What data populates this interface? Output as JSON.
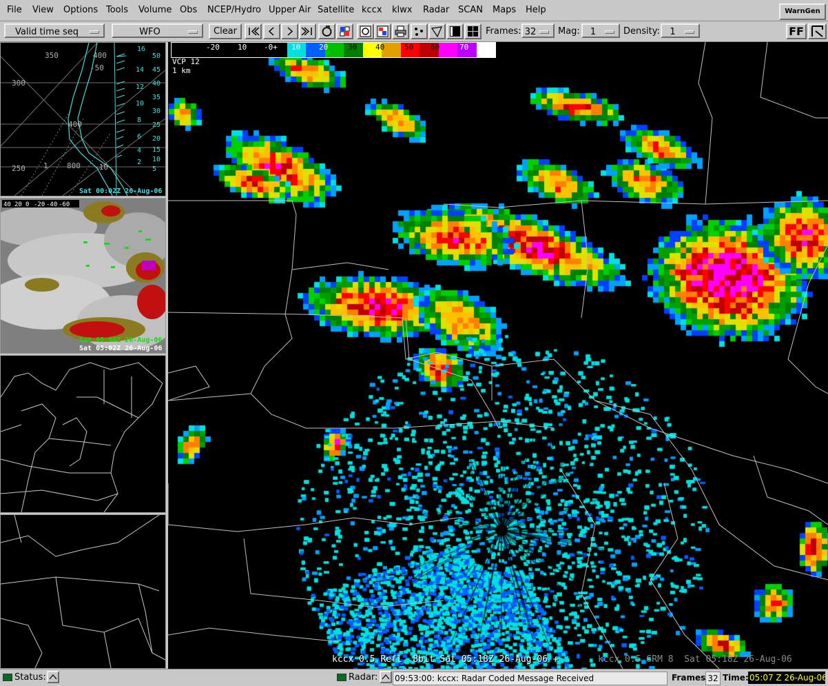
{
  "menubar": {
    "items": [
      "File",
      "View",
      "Options",
      "Tools",
      "Volume",
      "Obs",
      "NCEP/Hydro",
      "Upper Air",
      "Satellite",
      "kccx",
      "klwx",
      "Radar",
      "SCAN",
      "Maps",
      "Help"
    ],
    "warngen": "WarnGen"
  },
  "toolbar": {
    "time_mode": "Valid time seq",
    "scale": "WFO",
    "clear": "Clear",
    "frames_label": "Frames:",
    "frames_value": "32",
    "mag_label": "Mag:",
    "mag_value": "1",
    "density_label": "Density:",
    "density_value": "1",
    "ff_label": "FF"
  },
  "panels": {
    "skewt_pressures": [
      "350",
      "400",
      "300",
      "400",
      "250",
      "800"
    ],
    "skewt_temps": [
      "-50",
      "1",
      "-10"
    ],
    "skewt_heights_a": [
      "16",
      "14",
      "12",
      "10",
      "8",
      "6",
      "4",
      "2"
    ],
    "skewt_heights_b": [
      "50",
      "45",
      "40",
      "35",
      "30",
      "25",
      "20",
      "15",
      "10",
      "5"
    ],
    "skewt_time": "Sat 00:02Z 26-Aug-06",
    "sat_colorbar": [
      "40",
      "20",
      "0",
      "-20",
      "-40",
      "-60"
    ],
    "sat_time_1": "Sat 05:00Z 26-Aug-06",
    "sat_time_2": "Sat 05:02Z 26-Aug-06"
  },
  "radar": {
    "colorbar_labels": [
      "-20",
      "10",
      "-0+",
      "10",
      "20",
      "30",
      "40",
      "50",
      "60",
      "70"
    ],
    "colorbar_colors": [
      "#000000",
      "#707070",
      "#a0a0a0",
      "#00e0e0",
      "#0060ff",
      "#00c000",
      "#008000",
      "#ffff00",
      "#e0a000",
      "#ff0000",
      "#c00000",
      "#ff00ff",
      "#c000ff",
      "#ffffff"
    ],
    "vcp": "VCP 12",
    "height": "1 km",
    "legend_main": "kccx 0.5 Refl  8bit Sat 05:18Z 26-Aug-06 +",
    "legend_ghost": "kccx 0.5 SRM 8  Sat 05:18Z 26-Aug-06"
  },
  "statusbar": {
    "status_label": "Status:",
    "radar_label": "Radar:",
    "radar_message": "09:53:00: kccx: Radar Coded Message Received",
    "frames_label": "Frames:",
    "frames_value": "32",
    "time_label": "Time:",
    "time_value": "05:07 Z 26-Aug-06"
  }
}
